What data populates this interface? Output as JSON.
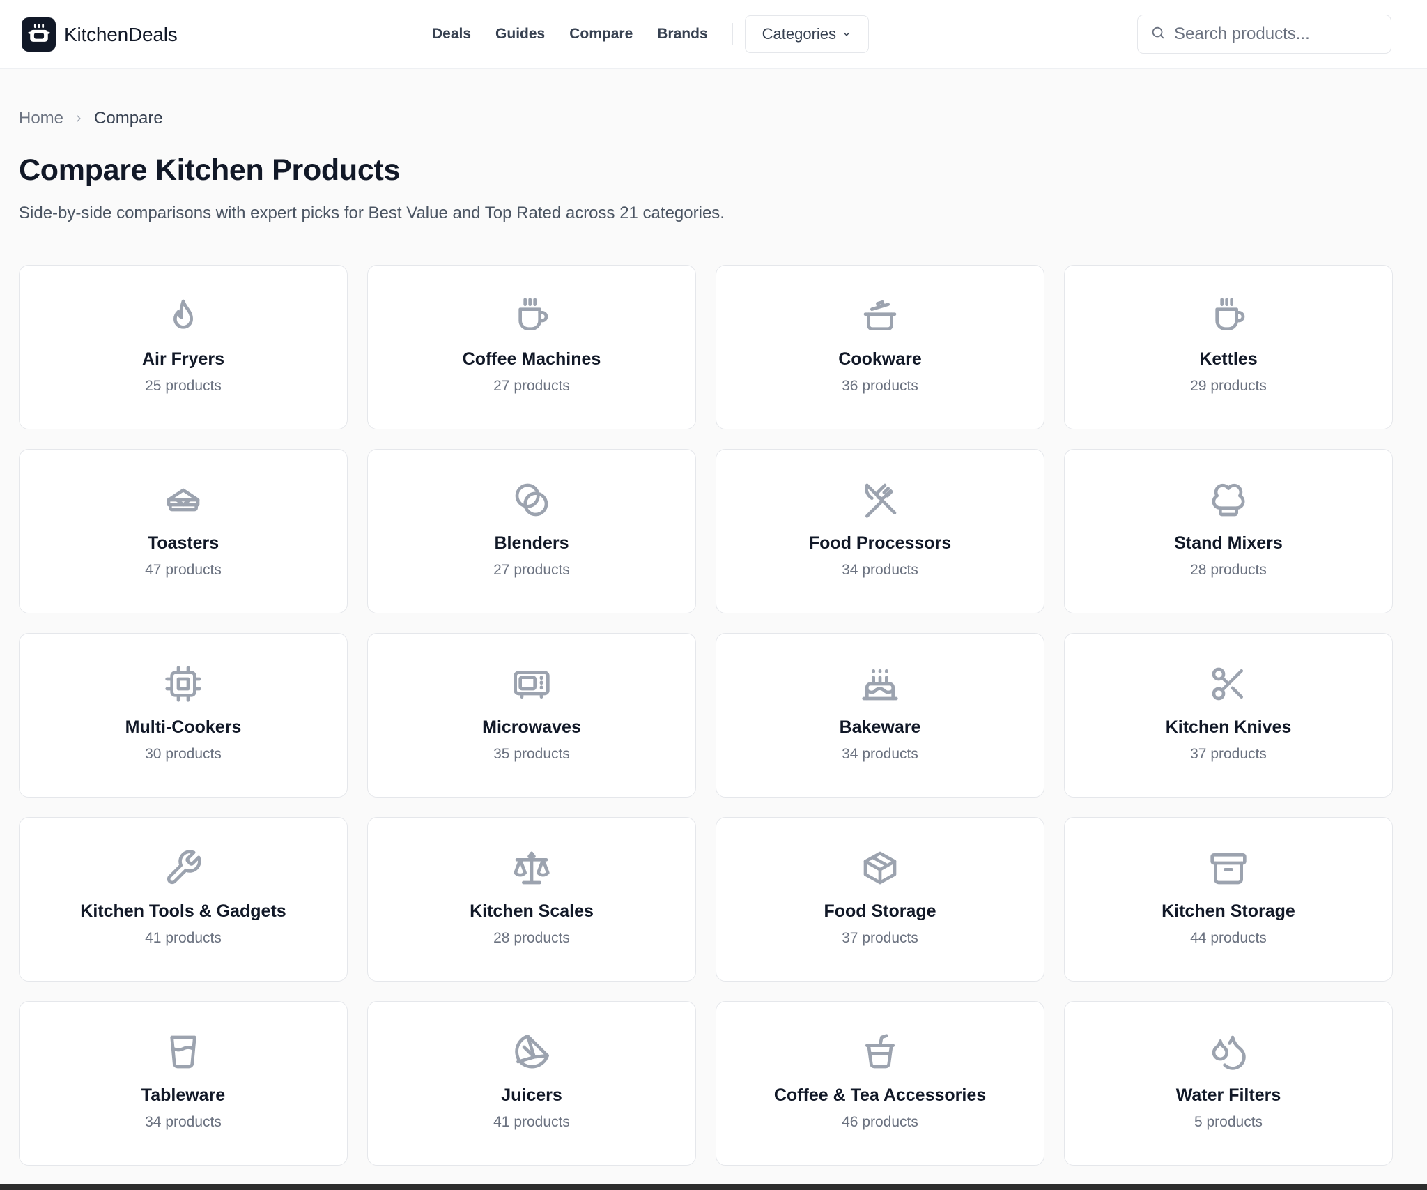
{
  "header": {
    "logo_text": "KitchenDeals",
    "nav": [
      "Deals",
      "Guides",
      "Compare",
      "Brands"
    ],
    "categories_label": "Categories",
    "search_placeholder": "Search products..."
  },
  "breadcrumb": {
    "home": "Home",
    "current": "Compare"
  },
  "page": {
    "title": "Compare Kitchen Products",
    "subtitle": "Side-by-side comparisons with expert picks for Best Value and Top Rated across 21 categories."
  },
  "categories": [
    {
      "name": "Air Fryers",
      "count": "25 products",
      "icon": "flame-icon"
    },
    {
      "name": "Coffee Machines",
      "count": "27 products",
      "icon": "coffee-cup-icon"
    },
    {
      "name": "Cookware",
      "count": "36 products",
      "icon": "cooking-pot-icon"
    },
    {
      "name": "Kettles",
      "count": "29 products",
      "icon": "coffee-cup-icon"
    },
    {
      "name": "Toasters",
      "count": "47 products",
      "icon": "sandwich-icon"
    },
    {
      "name": "Blenders",
      "count": "27 products",
      "icon": "circles-icon"
    },
    {
      "name": "Food Processors",
      "count": "34 products",
      "icon": "utensils-crossed-icon"
    },
    {
      "name": "Stand Mixers",
      "count": "28 products",
      "icon": "chef-hat-icon"
    },
    {
      "name": "Multi-Cookers",
      "count": "30 products",
      "icon": "cpu-chip-icon"
    },
    {
      "name": "Microwaves",
      "count": "35 products",
      "icon": "microwave-icon"
    },
    {
      "name": "Bakeware",
      "count": "34 products",
      "icon": "cake-icon"
    },
    {
      "name": "Kitchen Knives",
      "count": "37 products",
      "icon": "scissors-icon"
    },
    {
      "name": "Kitchen Tools & Gadgets",
      "count": "41 products",
      "icon": "wrench-icon"
    },
    {
      "name": "Kitchen Scales",
      "count": "28 products",
      "icon": "scale-icon"
    },
    {
      "name": "Food Storage",
      "count": "37 products",
      "icon": "package-icon"
    },
    {
      "name": "Kitchen Storage",
      "count": "44 products",
      "icon": "archive-icon"
    },
    {
      "name": "Tableware",
      "count": "34 products",
      "icon": "glass-icon"
    },
    {
      "name": "Juicers",
      "count": "41 products",
      "icon": "citrus-icon"
    },
    {
      "name": "Coffee & Tea Accessories",
      "count": "46 products",
      "icon": "cup-straw-icon"
    },
    {
      "name": "Water Filters",
      "count": "5 products",
      "icon": "droplets-icon"
    }
  ],
  "colors": {
    "icon": "#9ca3af",
    "text": "#111827",
    "muted": "#6b7280",
    "border": "#e5e7eb"
  }
}
